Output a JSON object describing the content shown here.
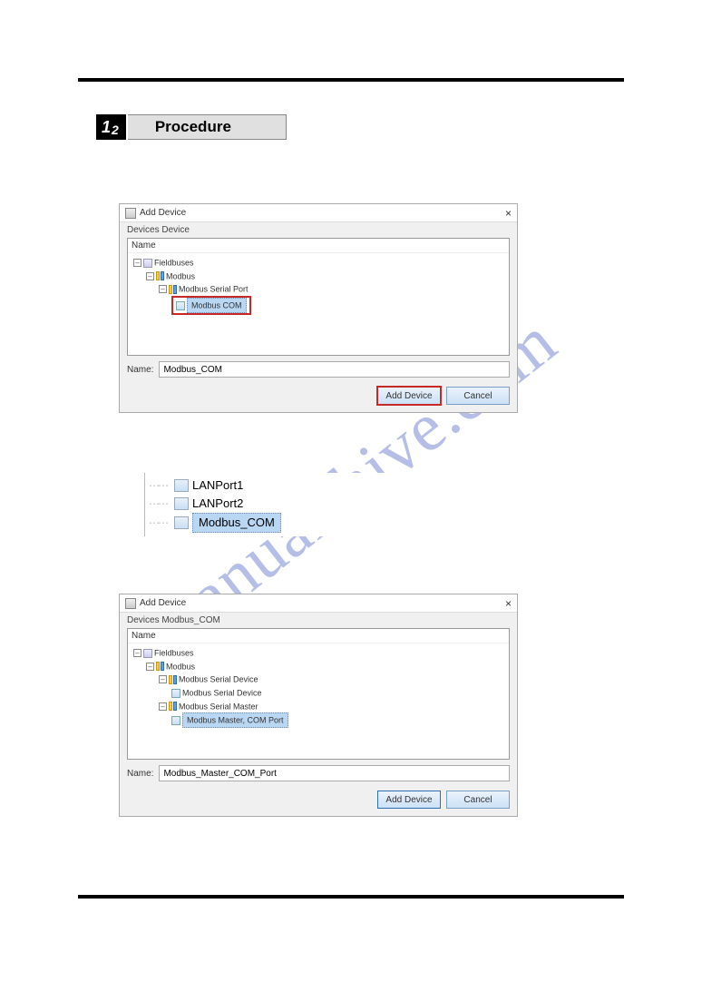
{
  "section": {
    "num_major": "1",
    "num_minor": "2",
    "title": "Procedure"
  },
  "watermark": "manualshive.com",
  "dialog1": {
    "title": "Add Device",
    "close": "×",
    "subtitle": "Devices    Device",
    "tree_header": "Name",
    "nodes": {
      "root": "Fieldbuses",
      "n1": "Modbus",
      "n2": "Modbus Serial Port",
      "n3": "Modbus COM"
    },
    "name_label": "Name:",
    "name_value": "Modbus_COM",
    "btn_add": "Add Device",
    "btn_cancel": "Cancel"
  },
  "midtree": {
    "item1": "LANPort1",
    "item2": "LANPort2",
    "item3": "Modbus_COM"
  },
  "dialog2": {
    "title": "Add Device",
    "close": "×",
    "subtitle": "Devices    Modbus_COM",
    "tree_header": "Name",
    "nodes": {
      "root": "Fieldbuses",
      "n1": "Modbus",
      "n2": "Modbus Serial Device",
      "n3": "Modbus Serial Device",
      "n4": "Modbus Serial Master",
      "n5": "Modbus Master, COM Port"
    },
    "name_label": "Name:",
    "name_value": "Modbus_Master_COM_Port",
    "btn_add": "Add Device",
    "btn_cancel": "Cancel"
  }
}
